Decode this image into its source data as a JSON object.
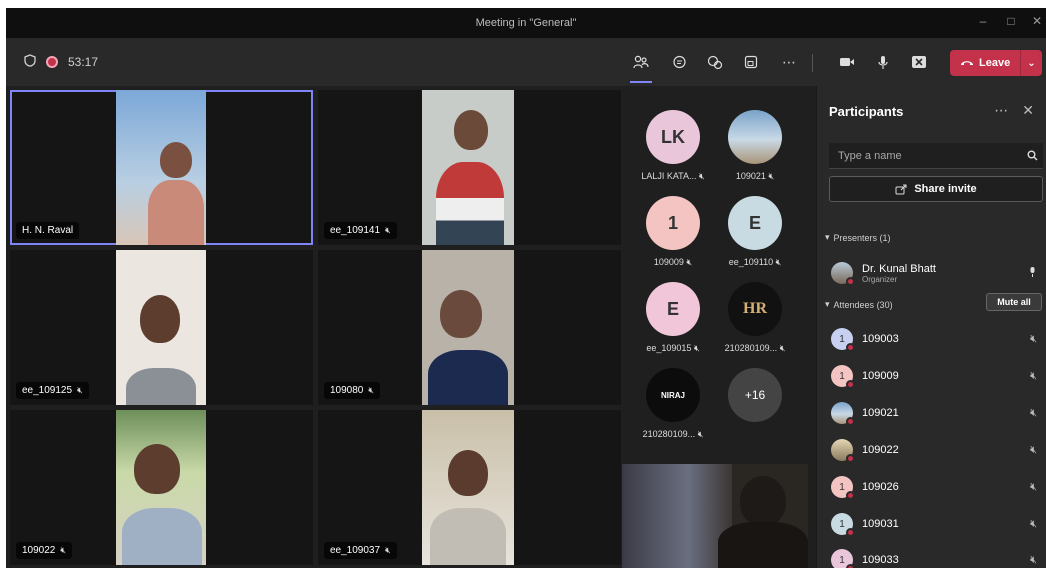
{
  "window": {
    "title": "Meeting in \"General\""
  },
  "toolbar": {
    "timer": "53:17",
    "leave_label": "Leave"
  },
  "tiles": [
    {
      "name": "H. N. Raval",
      "muted": false
    },
    {
      "name": "ee_109141",
      "muted": true
    },
    {
      "name": "ee_109125",
      "muted": true
    },
    {
      "name": "109080",
      "muted": true
    },
    {
      "name": "109022",
      "muted": true
    },
    {
      "name": "ee_109037",
      "muted": true
    }
  ],
  "avatars": [
    {
      "initials": "LK",
      "label": "LALJI KATA...",
      "color": "#e9c6da"
    },
    {
      "initials": "",
      "label": "109021",
      "color": "#7aa3c9"
    },
    {
      "initials": "1",
      "label": "109009",
      "color": "#f3c4c1"
    },
    {
      "initials": "E",
      "label": "ee_109110",
      "color": "#c8dbe2"
    },
    {
      "initials": "E",
      "label": "ee_109015",
      "color": "#f0c6d8"
    },
    {
      "initials": "HR",
      "label": "210280109...",
      "color": "#111111"
    },
    {
      "initials": "NIRAJ",
      "label": "210280109...",
      "color": "#0c0c0c"
    },
    {
      "initials": "+16",
      "label": "",
      "color": "#444444"
    }
  ],
  "panel": {
    "title": "Participants",
    "search_placeholder": "Type a name",
    "share_label": "Share invite",
    "presenters_header": "Presenters (1)",
    "presenter": {
      "name": "Dr. Kunal Bhatt",
      "role": "Organizer"
    },
    "attendees_header": "Attendees (30)",
    "mute_all_label": "Mute all",
    "attendees": [
      {
        "name": "109003",
        "initial": "1",
        "color": "#c8d0f0"
      },
      {
        "name": "109009",
        "initial": "1",
        "color": "#f3c4c1"
      },
      {
        "name": "109021",
        "initial": "",
        "color": "#7aa3c9"
      },
      {
        "name": "109022",
        "initial": "",
        "color": "#8a7a5e"
      },
      {
        "name": "109026",
        "initial": "1",
        "color": "#f3c4c1"
      },
      {
        "name": "109031",
        "initial": "1",
        "color": "#c8dbe2"
      },
      {
        "name": "109033",
        "initial": "1",
        "color": "#e9c6da"
      }
    ]
  }
}
